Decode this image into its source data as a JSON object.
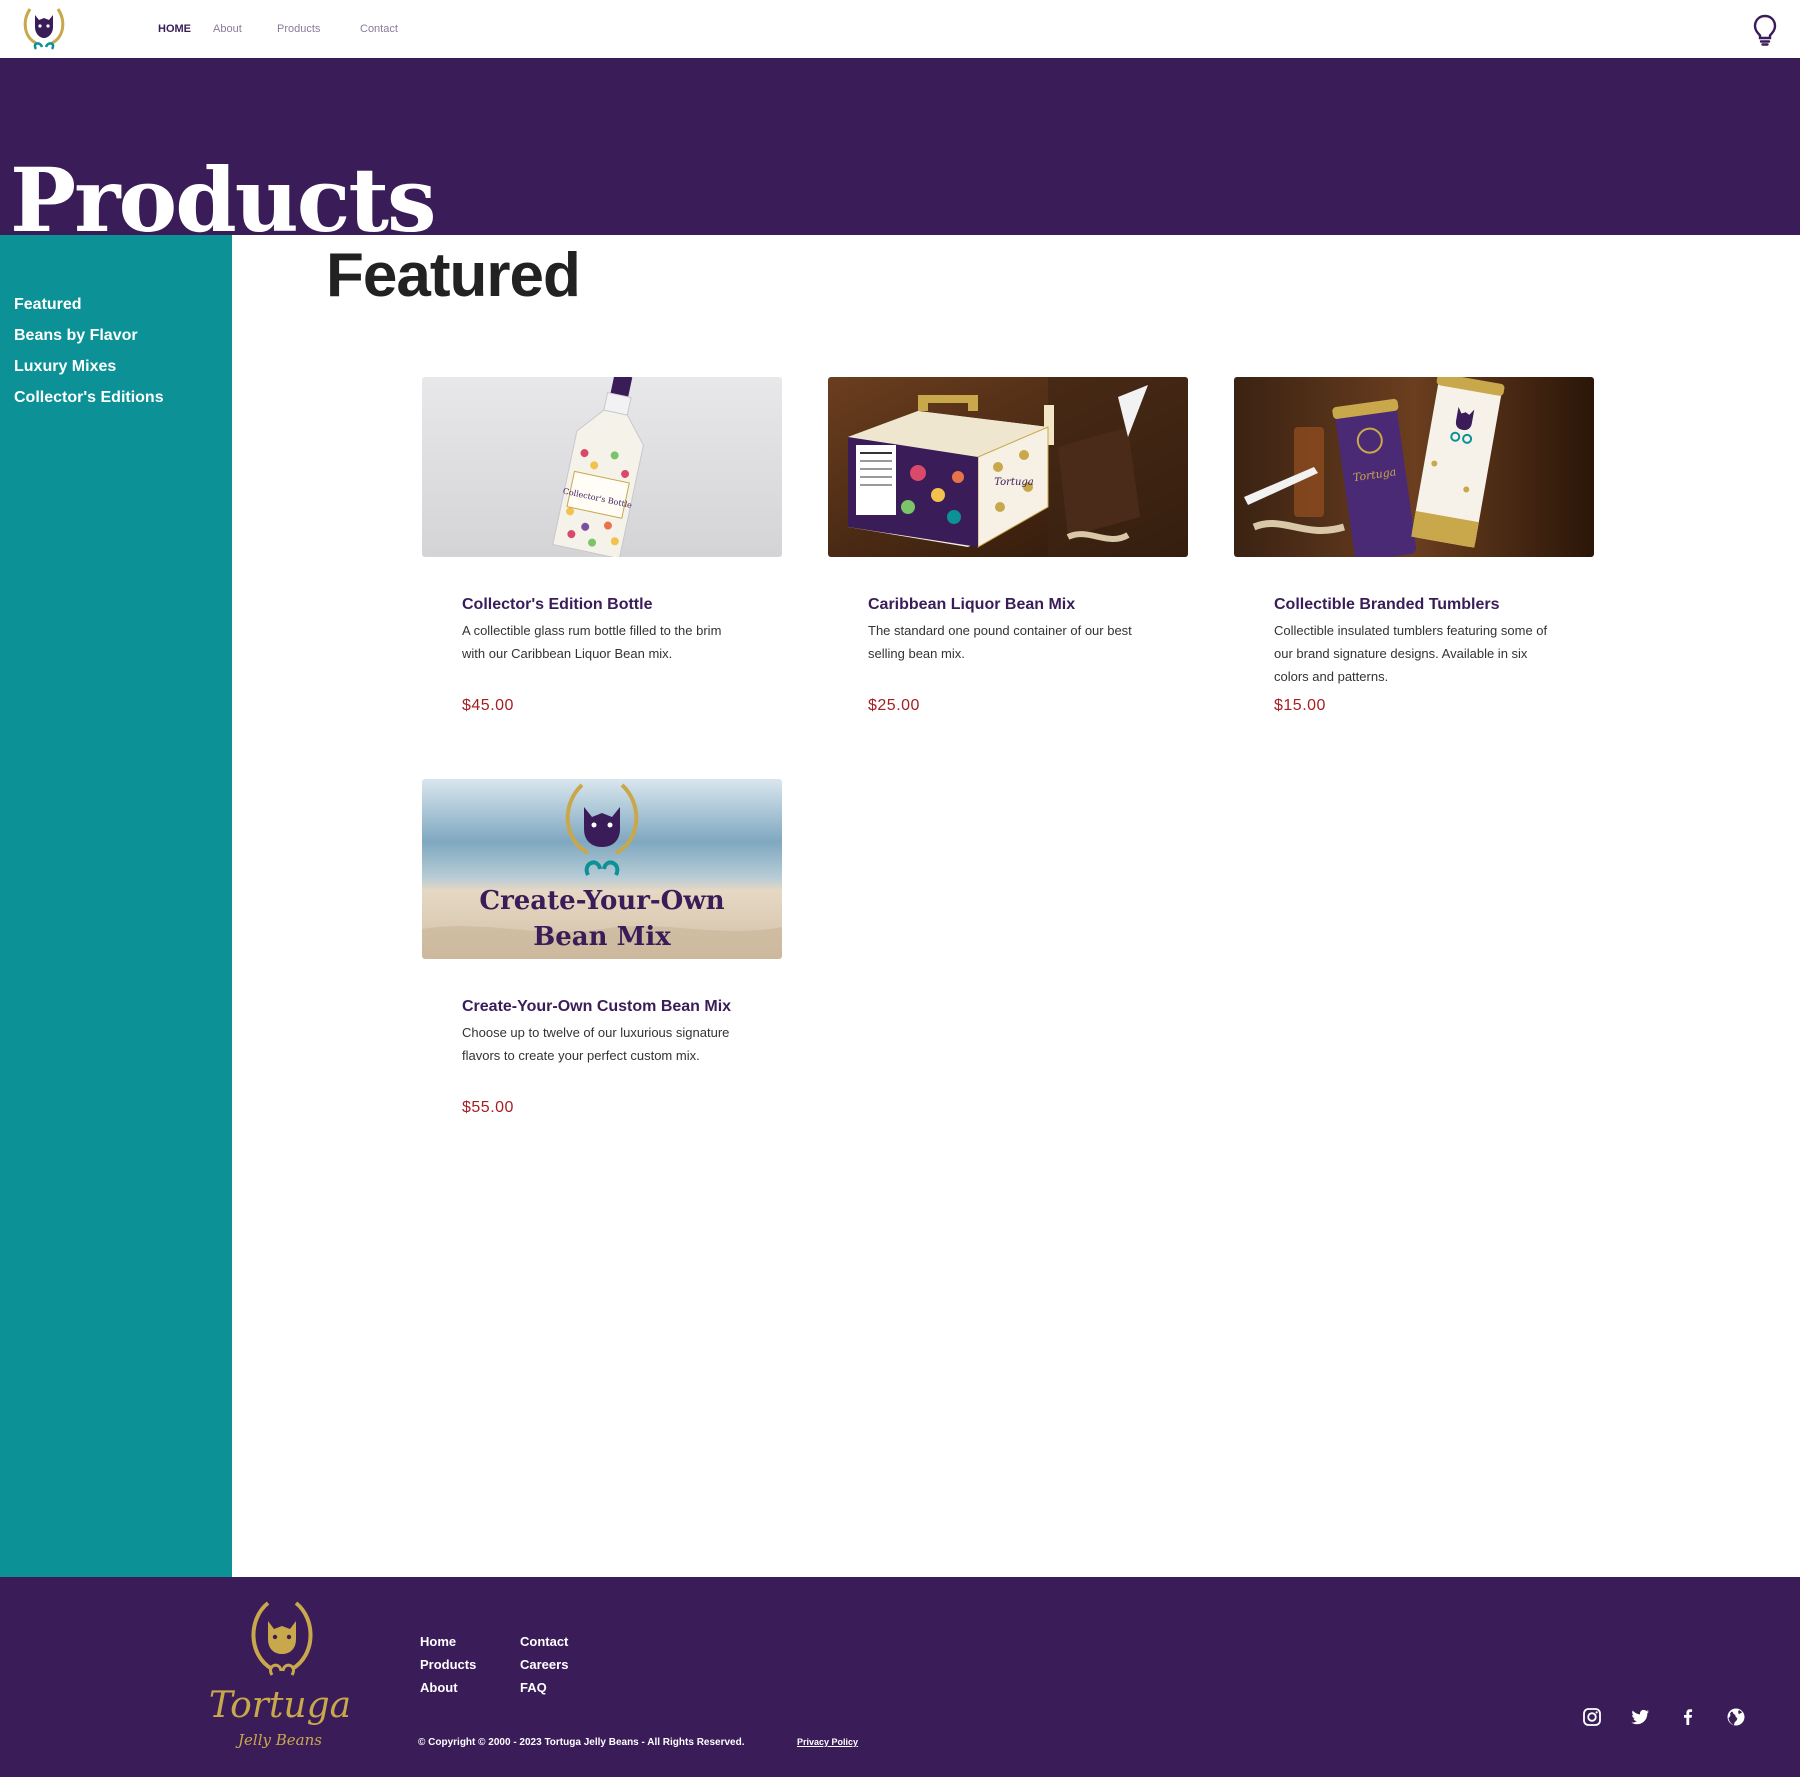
{
  "header": {
    "nav": [
      {
        "label": "HOME"
      },
      {
        "label": "About"
      },
      {
        "label": "Products"
      },
      {
        "label": "Contact"
      }
    ]
  },
  "hero": {
    "title": "Products"
  },
  "sidebar": {
    "items": [
      {
        "label": "Featured"
      },
      {
        "label": "Beans by Flavor"
      },
      {
        "label": "Luxury Mixes"
      },
      {
        "label": "Collector's Editions"
      }
    ]
  },
  "main": {
    "section_title": "Featured",
    "products": [
      {
        "name": "Collector's Edition Bottle",
        "description": "A collectible glass rum bottle filled to the brim with our Caribbean Liquor Bean mix.",
        "price": "$45.00",
        "image_label": "Collector's Bottle"
      },
      {
        "name": "Caribbean Liquor Bean Mix",
        "description": "The standard one pound container of our best selling bean mix.",
        "price": "$25.00",
        "image_label": "Tortuga"
      },
      {
        "name": "Collectible Branded Tumblers",
        "description": "Collectible insulated tumblers featuring some of our brand signature designs. Available in six colors and patterns.",
        "price": "$15.00",
        "image_label": "Tortuga"
      },
      {
        "name": "Create-Your-Own Custom Bean Mix",
        "description": "Choose up to twelve of our luxurious signature flavors to create your perfect custom mix.",
        "price": "$55.00",
        "image_label_line1": "Create-Your-Own",
        "image_label_line2": "Bean Mix"
      }
    ]
  },
  "footer": {
    "brand_line1": "Tortuga",
    "brand_line2": "Jelly Beans",
    "links_col1": [
      {
        "label": "Home"
      },
      {
        "label": "Products"
      },
      {
        "label": "About"
      }
    ],
    "links_col2": [
      {
        "label": "Contact"
      },
      {
        "label": "Careers"
      },
      {
        "label": "FAQ"
      }
    ],
    "copyright": "© Copyright © 2000 - 2023 Tortuga Jelly Beans - All Rights Reserved.",
    "privacy": "Privacy Policy",
    "social_icons": [
      "instagram-icon",
      "twitter-icon",
      "facebook-icon",
      "globe-icon"
    ]
  },
  "colors": {
    "purple": "#3a1c58",
    "teal": "#0b9196",
    "gold": "#c9a84c",
    "price_red": "#a51f22"
  }
}
